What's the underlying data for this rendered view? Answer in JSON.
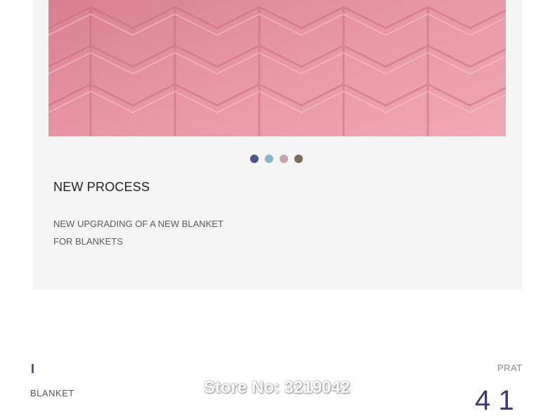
{
  "carousel": {
    "dots": [
      {
        "name": "dot-navy",
        "color": "#4f5488"
      },
      {
        "name": "dot-lightblue",
        "color": "#8cb4c8"
      },
      {
        "name": "dot-pink",
        "color": "#c9a2b1"
      },
      {
        "name": "dot-brown",
        "color": "#7a6a62"
      }
    ]
  },
  "feature": {
    "heading": "NEW PROCESS",
    "description_line1": "NEW UPGRADING OF A NEW BLANKET",
    "description_line2": "FOR BLANKETS"
  },
  "next_section": {
    "label": "BLANKET",
    "part_label": "PRAT",
    "part_number": "4 1"
  },
  "watermark": {
    "text": "Store No: 3219042"
  },
  "colors": {
    "card_background": "#f5f5f5",
    "blanket_pink": "#e796a1",
    "accent": "#55588c"
  }
}
